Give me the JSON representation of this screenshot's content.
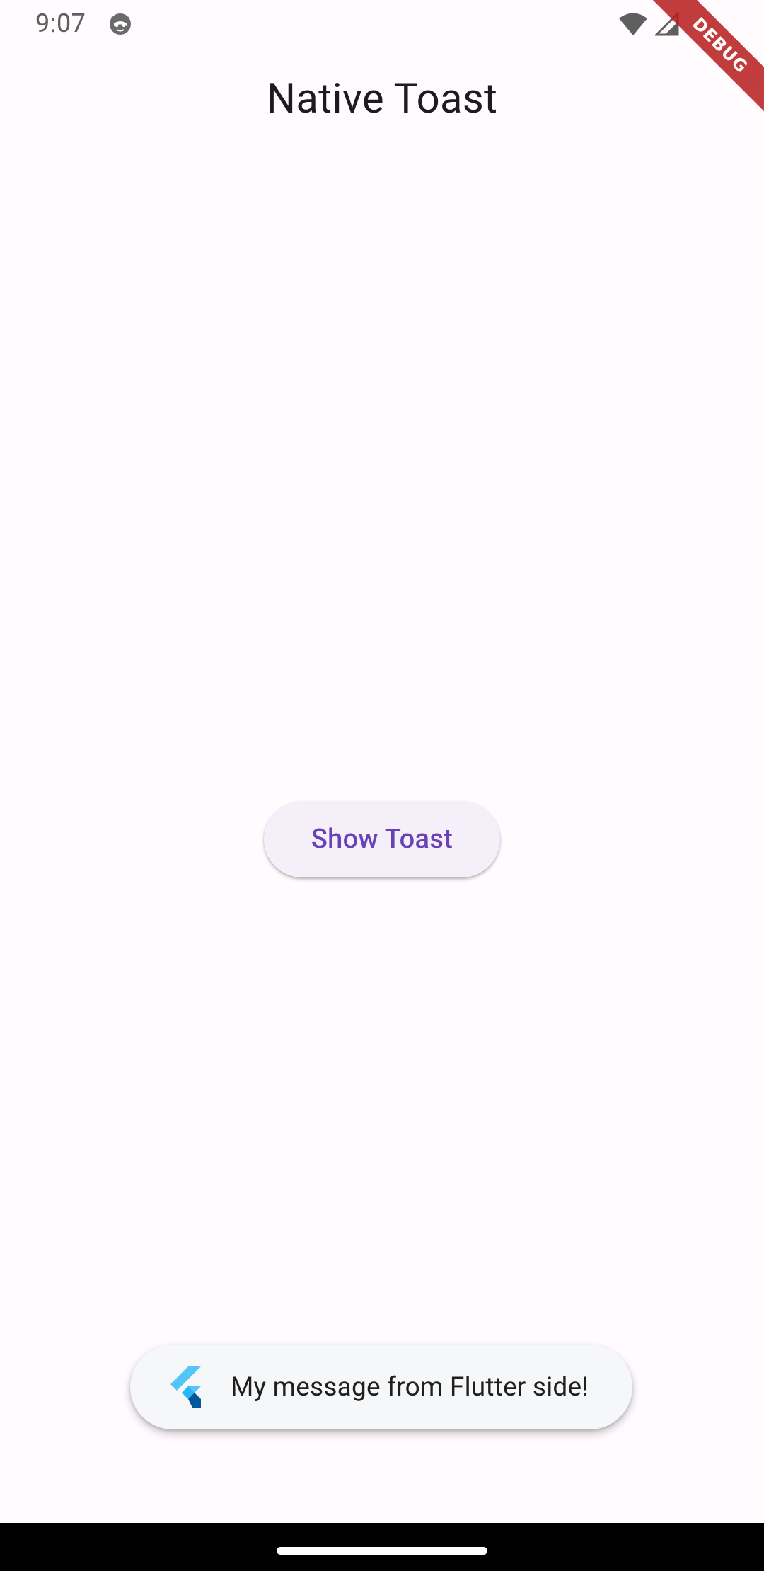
{
  "status_bar": {
    "time": "9:07",
    "notification_icon": "cat-face-icon",
    "wifi_icon": "wifi-icon",
    "signal_icon": "cellular-signal-icon"
  },
  "debug_banner": {
    "label": "DEBUG",
    "color": "#b71c1c"
  },
  "app_bar": {
    "title": "Native Toast"
  },
  "main": {
    "show_toast_label": "Show Toast",
    "button_text_color": "#6a42b8",
    "button_bg_color": "#f5eff9"
  },
  "toast": {
    "icon": "flutter-logo-icon",
    "message": "My message from Flutter side!"
  },
  "navigation": {
    "home_handle": "home-gesture-handle"
  },
  "colors": {
    "background": "#fffbfe",
    "nav_bar": "#000000"
  }
}
